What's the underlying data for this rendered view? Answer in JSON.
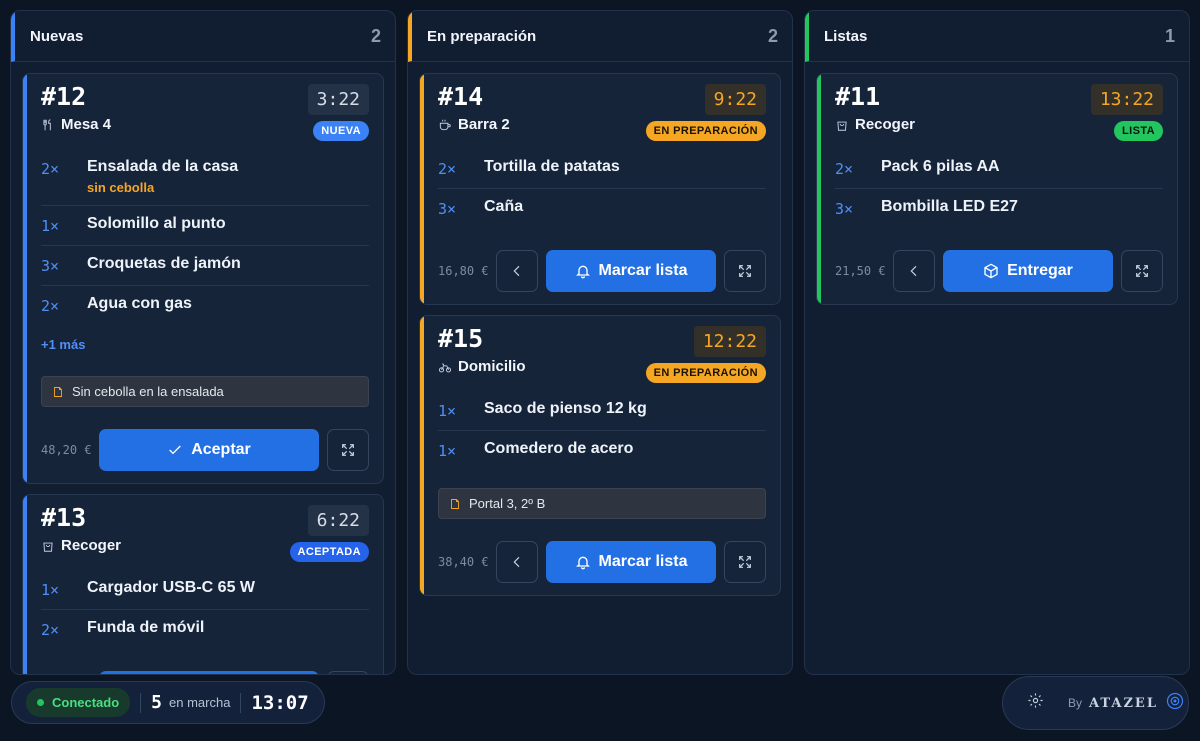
{
  "columns": [
    {
      "title": "Nuevas",
      "count": "2",
      "accent": "#3b82f6",
      "cards": [
        {
          "number": "#12",
          "location": "Mesa 4",
          "location_icon": "utensils-icon",
          "timer": "3:22",
          "timer_warn": false,
          "badge": "NUEVA",
          "badge_style": "b-new",
          "items": [
            {
              "qty": "2×",
              "name": "Ensalada de la casa",
              "note": "sin cebolla"
            },
            {
              "qty": "1×",
              "name": "Solomillo al punto"
            },
            {
              "qty": "3×",
              "name": "Croquetas de jamón"
            },
            {
              "qty": "2×",
              "name": "Agua con gas"
            }
          ],
          "more": "+1 más",
          "note": "Sin cebolla en la ensalada",
          "total": "48,20 €",
          "action": "Aceptar",
          "action_icon": "check-icon",
          "back": false
        },
        {
          "number": "#13",
          "location": "Recoger",
          "location_icon": "bag-icon",
          "timer": "6:22",
          "timer_warn": false,
          "badge": "ACEPTADA",
          "badge_style": "b-acc",
          "items": [
            {
              "qty": "1×",
              "name": "Cargador USB-C 65 W"
            },
            {
              "qty": "2×",
              "name": "Funda de móvil"
            }
          ],
          "total": "",
          "action": "",
          "action_icon": "check-icon",
          "back": false
        }
      ]
    },
    {
      "title": "En preparación",
      "count": "2",
      "accent": "#f5a623",
      "cards": [
        {
          "number": "#14",
          "location": "Barra 2",
          "location_icon": "cup-icon",
          "timer": "9:22",
          "timer_warn": true,
          "badge": "EN PREPARACIÓN",
          "badge_style": "b-prep",
          "items": [
            {
              "qty": "2×",
              "name": "Tortilla de patatas"
            },
            {
              "qty": "3×",
              "name": "Caña"
            }
          ],
          "total": "16,80 €",
          "action": "Marcar lista",
          "action_icon": "bell-icon",
          "back": true
        },
        {
          "number": "#15",
          "location": "Domicilio",
          "location_icon": "bike-icon",
          "timer": "12:22",
          "timer_warn": true,
          "badge": "EN PREPARACIÓN",
          "badge_style": "b-prep",
          "items": [
            {
              "qty": "1×",
              "name": "Saco de pienso 12 kg"
            },
            {
              "qty": "1×",
              "name": "Comedero de acero"
            }
          ],
          "note": "Portal 3, 2º B",
          "total": "38,40 €",
          "action": "Marcar lista",
          "action_icon": "bell-icon",
          "back": true
        }
      ]
    },
    {
      "title": "Listas",
      "count": "1",
      "accent": "#22c55e",
      "cards": [
        {
          "number": "#11",
          "location": "Recoger",
          "location_icon": "bag-icon",
          "timer": "13:22",
          "timer_warn": true,
          "badge": "LISTA",
          "badge_style": "b-ready",
          "items": [
            {
              "qty": "2×",
              "name": "Pack 6 pilas AA"
            },
            {
              "qty": "3×",
              "name": "Bombilla LED E27"
            }
          ],
          "total": "21,50 €",
          "action": "Entregar",
          "action_icon": "box-icon",
          "back": true
        }
      ]
    }
  ],
  "status": {
    "connection": "Conectado",
    "running_count": "5",
    "running_label": "en marcha",
    "clock": "13:07"
  },
  "brand": {
    "by": "By",
    "name": "ATAZEL"
  }
}
